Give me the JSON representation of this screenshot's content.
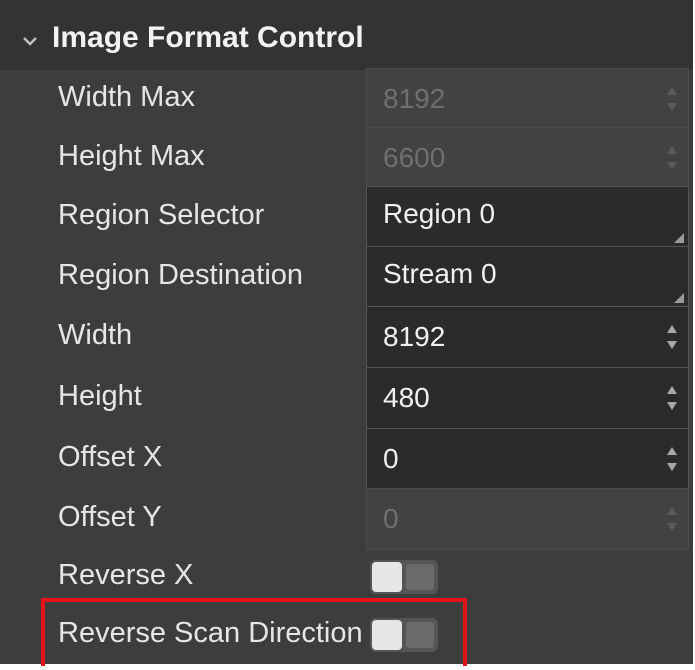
{
  "section": {
    "title": "Image Format Control",
    "expand_icon": "chevron-down-icon"
  },
  "rows": [
    {
      "label": "Width Max",
      "value": "8192",
      "kind": "spinbox",
      "enabled": false
    },
    {
      "label": "Height Max",
      "value": "6600",
      "kind": "spinbox",
      "enabled": false
    },
    {
      "label": "Region Selector",
      "value": "Region 0",
      "kind": "dropdown",
      "enabled": true
    },
    {
      "label": "Region Destination",
      "value": "Stream 0",
      "kind": "dropdown",
      "enabled": true
    },
    {
      "label": "Width",
      "value": "8192",
      "kind": "spinbox",
      "enabled": true
    },
    {
      "label": "Height",
      "value": "480",
      "kind": "spinbox",
      "enabled": true
    },
    {
      "label": "Offset X",
      "value": "0",
      "kind": "spinbox",
      "enabled": true
    },
    {
      "label": "Offset Y",
      "value": "0",
      "kind": "spinbox",
      "enabled": false
    },
    {
      "label": "Reverse X",
      "value": "off",
      "kind": "toggle",
      "enabled": true
    },
    {
      "label": "Reverse Scan Direction",
      "value": "off",
      "kind": "toggle",
      "enabled": true,
      "highlighted": true
    }
  ],
  "colors": {
    "panel_bg": "#3d3d3d",
    "input_bg": "#2b2b2b",
    "disabled_input_bg": "#424242",
    "highlight": "#e3151b"
  }
}
